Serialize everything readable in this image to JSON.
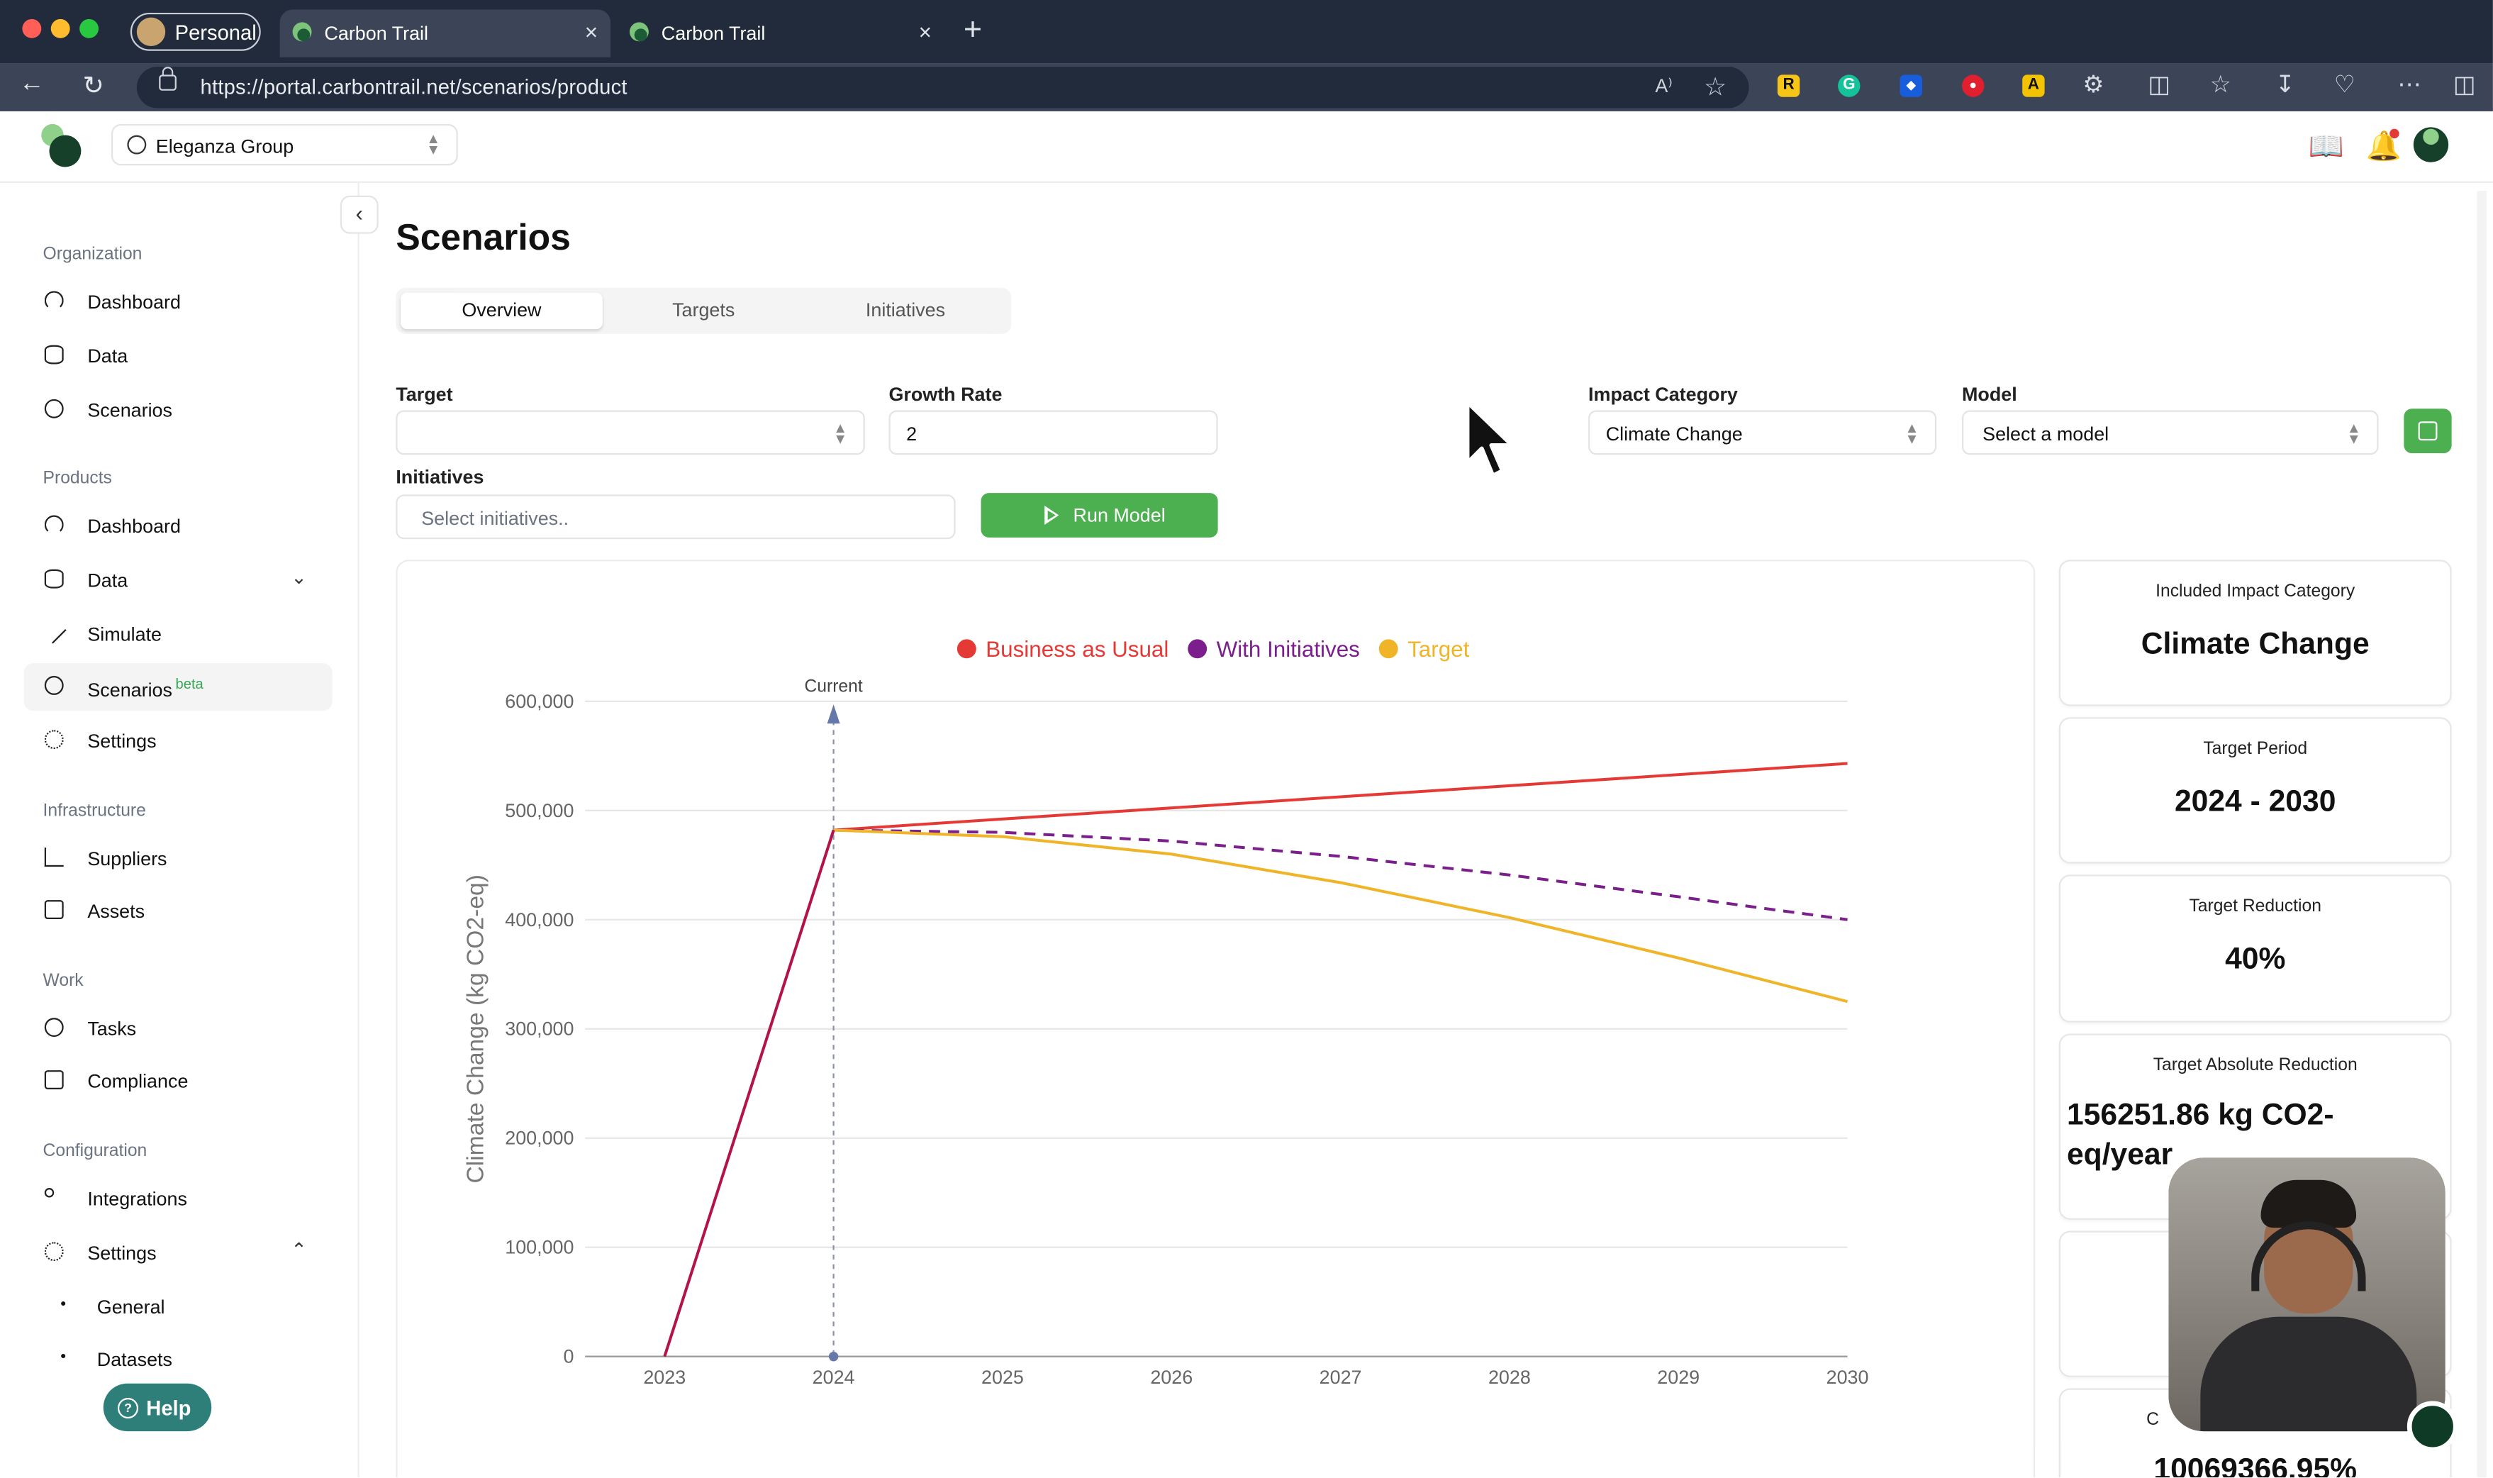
{
  "browser": {
    "profile_label": "Personal",
    "tabs": [
      {
        "title": "Carbon Trail",
        "close": "×"
      },
      {
        "title": "Carbon Trail",
        "close": "×"
      }
    ],
    "new_tab": "+",
    "url": "https://portal.carbontrail.net/scenarios/product",
    "read_aloud": "A⁾",
    "extensions": [
      {
        "name": "r-extension-icon",
        "color": "#f5c518",
        "glyph": "R"
      },
      {
        "name": "grammarly-icon",
        "color": "#15c39a",
        "glyph": "G"
      },
      {
        "name": "bitwarden-icon",
        "color": "#175ddc",
        "glyph": "◆"
      },
      {
        "name": "stop-extension-icon",
        "color": "#e0202f",
        "glyph": "●"
      },
      {
        "name": "a-extension-icon",
        "color": "#f3c200",
        "glyph": "A"
      }
    ]
  },
  "header": {
    "org_name": "Eleganza Group"
  },
  "sidebar": {
    "sections": {
      "organization": "Organization",
      "products": "Products",
      "infrastructure": "Infrastructure",
      "work": "Work",
      "configuration": "Configuration"
    },
    "org_items": {
      "dashboard": "Dashboard",
      "data": "Data",
      "scenarios": "Scenarios"
    },
    "product_items": {
      "dashboard": "Dashboard",
      "data": "Data",
      "simulate": "Simulate",
      "scenarios": "Scenarios",
      "scenarios_badge": "beta",
      "settings": "Settings"
    },
    "infra_items": {
      "suppliers": "Suppliers",
      "assets": "Assets"
    },
    "work_items": {
      "tasks": "Tasks",
      "compliance": "Compliance"
    },
    "config_items": {
      "integrations": "Integrations",
      "settings": "Settings",
      "general": "General",
      "datasets": "Datasets"
    },
    "help": "Help"
  },
  "main": {
    "title": "Scenarios",
    "tabs": [
      "Overview",
      "Targets",
      "Initiatives"
    ],
    "form": {
      "target_label": "Target",
      "target_value": "",
      "growth_label": "Growth Rate",
      "growth_value": "2",
      "initiatives_label": "Initiatives",
      "initiatives_placeholder": "Select initiatives..",
      "impact_label": "Impact Category",
      "impact_value": "Climate Change",
      "model_label": "Model",
      "model_value": "Select a model",
      "run_label": "Run Model"
    },
    "summary": [
      {
        "heading": "Included Impact Category",
        "value": "Climate Change"
      },
      {
        "heading": "Target Period",
        "value": "2024 - 2030"
      },
      {
        "heading": "Target Reduction",
        "value": "40%"
      },
      {
        "heading": "Target Absolute Reduction",
        "value": "156251.86 kg CO2-eq/year"
      },
      {
        "heading": "",
        "value": ""
      },
      {
        "heading": "C",
        "value": "10069366.95%"
      }
    ]
  },
  "chart_data": {
    "type": "line",
    "x": [
      2023,
      2024,
      2025,
      2026,
      2027,
      2028,
      2029,
      2030
    ],
    "ylabel": "Climate Change (kg CO2-eq)",
    "ylim": [
      0,
      600000
    ],
    "yticks": [
      0,
      100000,
      200000,
      300000,
      400000,
      500000,
      600000
    ],
    "yticklabels": [
      "0",
      "100,000",
      "200,000",
      "300,000",
      "400,000",
      "500,000",
      "600,000"
    ],
    "legend_position": "top-center",
    "current_marker": {
      "x": 2024,
      "label": "Current"
    },
    "series": [
      {
        "name": "Business as Usual",
        "color": "#e53935",
        "dash": false,
        "x": [
          2024,
          2030
        ],
        "values": [
          482000,
          543000
        ]
      },
      {
        "name": "With Initiatives",
        "color": "#7b1f8c",
        "dash": true,
        "x": [
          2024,
          2025,
          2026,
          2027,
          2028,
          2029,
          2030
        ],
        "values": [
          482000,
          480000,
          472000,
          458000,
          441000,
          421000,
          400000
        ]
      },
      {
        "name": "Target",
        "color": "#f0b429",
        "dash": false,
        "x": [
          2024,
          2025,
          2026,
          2027,
          2028,
          2029,
          2030
        ],
        "values": [
          482000,
          476000,
          460000,
          434000,
          402000,
          365000,
          325000
        ]
      },
      {
        "name": "",
        "color": "#b3134a",
        "dash": false,
        "x": [
          2023,
          2024
        ],
        "values": [
          0,
          482000
        ]
      }
    ]
  }
}
